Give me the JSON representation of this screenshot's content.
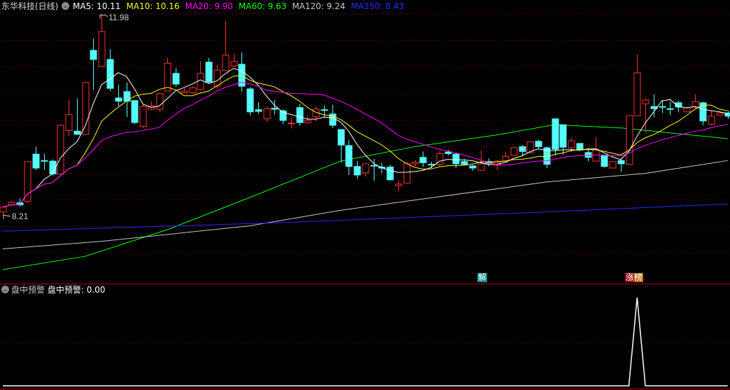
{
  "header": {
    "title": "东华科技(日线)",
    "ma_legend": [
      {
        "name": "MA5",
        "value": "10.11",
        "color": "#ffffff"
      },
      {
        "name": "MA10",
        "value": "10.16",
        "color": "#ffff00"
      },
      {
        "name": "MA20",
        "value": "9.90",
        "color": "#ff00ff"
      },
      {
        "name": "MA60",
        "value": "9.63",
        "color": "#00ff00"
      },
      {
        "name": "MA120",
        "value": "9.24",
        "color": "#c8c8c8"
      },
      {
        "name": "MA250",
        "value": "8.43",
        "color": "#2a2aff"
      }
    ]
  },
  "indicator": {
    "title": "盘中预警",
    "label": "盘中预警",
    "value": "0.00"
  },
  "markers": {
    "jie": "解",
    "zhangbang": "涨榜"
  },
  "annotations": {
    "high": "11.98",
    "low": "8.21"
  },
  "colors": {
    "up": "#ff3232",
    "down": "#54fcfc",
    "grid": "#8b0000",
    "border": "#b00000"
  },
  "chart_data": {
    "type": "candlestick",
    "title": "东华科技(日线)",
    "ylim": [
      6.9,
      12.0
    ],
    "ohlc": [
      [
        8.28,
        8.38,
        8.21,
        8.37
      ],
      [
        8.41,
        8.48,
        8.38,
        8.46
      ],
      [
        8.45,
        8.53,
        8.38,
        8.41
      ],
      [
        8.48,
        9.22,
        8.45,
        9.22
      ],
      [
        9.36,
        9.5,
        9.06,
        9.1
      ],
      [
        9.24,
        9.37,
        9.07,
        9.23
      ],
      [
        9.23,
        9.26,
        8.96,
        8.99
      ],
      [
        8.99,
        9.9,
        8.97,
        9.9
      ],
      [
        9.8,
        10.38,
        9.7,
        10.1
      ],
      [
        9.79,
        10.4,
        9.73,
        9.73
      ],
      [
        9.73,
        10.7,
        9.73,
        10.7
      ],
      [
        11.3,
        11.52,
        10.56,
        11.13
      ],
      [
        11.0,
        11.98,
        11.0,
        11.65
      ],
      [
        11.13,
        11.32,
        10.54,
        10.59
      ],
      [
        10.41,
        10.66,
        10.26,
        10.35
      ],
      [
        10.53,
        10.7,
        10.05,
        10.35
      ],
      [
        10.36,
        10.37,
        9.92,
        9.95
      ],
      [
        9.88,
        10.3,
        9.85,
        10.25
      ],
      [
        10.2,
        10.35,
        10.18,
        10.26
      ],
      [
        10.2,
        10.49,
        10.14,
        10.49
      ],
      [
        10.54,
        11.17,
        10.54,
        11.06
      ],
      [
        10.87,
        10.97,
        10.62,
        10.67
      ],
      [
        10.51,
        10.59,
        10.5,
        10.54
      ],
      [
        10.51,
        10.62,
        10.49,
        10.6
      ],
      [
        10.57,
        11.1,
        10.55,
        10.87
      ],
      [
        11.08,
        11.16,
        10.68,
        10.71
      ],
      [
        10.63,
        11.03,
        10.58,
        10.93
      ],
      [
        10.92,
        11.85,
        10.92,
        11.21
      ],
      [
        11.01,
        11.23,
        10.98,
        11.09
      ],
      [
        11.04,
        11.26,
        10.53,
        10.63
      ],
      [
        10.58,
        10.61,
        10.08,
        10.15
      ],
      [
        10.19,
        10.33,
        10.11,
        10.16
      ],
      [
        10.02,
        10.25,
        9.96,
        10.21
      ],
      [
        10.22,
        10.37,
        10.1,
        10.2
      ],
      [
        10.17,
        10.2,
        9.92,
        9.99
      ],
      [
        9.93,
        10.05,
        9.84,
        9.94
      ],
      [
        10.23,
        10.3,
        9.89,
        9.95
      ],
      [
        9.95,
        10.08,
        9.93,
        9.99
      ],
      [
        10.06,
        10.25,
        9.97,
        10.2
      ],
      [
        10.19,
        10.27,
        10.04,
        10.18
      ],
      [
        10.11,
        10.28,
        9.85,
        9.9
      ],
      [
        9.82,
        9.82,
        9.2,
        9.53
      ],
      [
        9.52,
        9.62,
        8.97,
        9.13
      ],
      [
        9.13,
        9.23,
        8.9,
        8.97
      ],
      [
        9.01,
        9.18,
        8.94,
        9.18
      ],
      [
        9.15,
        9.27,
        8.86,
        9.14
      ],
      [
        9.12,
        9.2,
        9.0,
        9.1
      ],
      [
        9.12,
        9.16,
        8.87,
        8.88
      ],
      [
        8.77,
        8.86,
        8.67,
        8.8
      ],
      [
        8.82,
        9.21,
        8.81,
        9.19
      ],
      [
        9.18,
        9.25,
        9.14,
        9.21
      ],
      [
        9.3,
        9.41,
        9.12,
        9.2
      ],
      [
        9.17,
        9.22,
        9.1,
        9.16
      ],
      [
        9.17,
        9.42,
        9.14,
        9.37
      ],
      [
        9.4,
        9.44,
        9.33,
        9.37
      ],
      [
        9.36,
        9.38,
        9.1,
        9.18
      ],
      [
        9.22,
        9.27,
        9.15,
        9.17
      ],
      [
        9.14,
        9.16,
        9.05,
        9.1
      ],
      [
        9.06,
        9.43,
        9.06,
        9.18
      ],
      [
        9.22,
        9.28,
        9.13,
        9.19
      ],
      [
        9.15,
        9.25,
        9.06,
        9.23
      ],
      [
        9.24,
        9.4,
        9.2,
        9.32
      ],
      [
        9.34,
        9.48,
        9.34,
        9.48
      ],
      [
        9.5,
        9.53,
        9.34,
        9.41
      ],
      [
        9.39,
        9.59,
        9.36,
        9.59
      ],
      [
        9.6,
        9.63,
        9.47,
        9.5
      ],
      [
        9.48,
        9.5,
        9.1,
        9.17
      ],
      [
        10.02,
        10.02,
        9.34,
        9.45
      ],
      [
        9.91,
        9.91,
        9.35,
        9.49
      ],
      [
        9.48,
        9.66,
        9.4,
        9.61
      ],
      [
        9.56,
        9.56,
        9.44,
        9.44
      ],
      [
        9.39,
        9.44,
        9.23,
        9.3
      ],
      [
        9.23,
        9.68,
        9.23,
        9.45
      ],
      [
        9.34,
        9.35,
        9.11,
        9.13
      ],
      [
        9.1,
        9.22,
        9.1,
        9.22
      ],
      [
        9.24,
        9.29,
        9.03,
        9.18
      ],
      [
        9.17,
        10.08,
        9.17,
        10.08
      ],
      [
        10.08,
        11.22,
        10.08,
        10.88
      ],
      [
        10.3,
        10.4,
        9.77,
        10.37
      ],
      [
        10.25,
        10.48,
        10.05,
        10.21
      ],
      [
        10.25,
        10.37,
        10.13,
        10.24
      ],
      [
        10.21,
        10.33,
        10.09,
        10.2
      ],
      [
        10.32,
        10.36,
        10.14,
        10.24
      ],
      [
        10.15,
        10.25,
        10.15,
        10.23
      ],
      [
        10.24,
        10.48,
        10.2,
        10.34
      ],
      [
        10.32,
        10.34,
        9.9,
        9.98
      ],
      [
        9.92,
        10.17,
        9.9,
        10.07
      ],
      [
        10.09,
        10.16,
        10.09,
        10.13
      ],
      [
        10.13,
        10.17,
        10.02,
        10.07
      ]
    ],
    "long_ma": [
      {
        "name": "MA60",
        "color": "#00ff00",
        "points": [
          [
            0,
            7.2
          ],
          [
            10,
            7.45
          ],
          [
            20,
            7.95
          ],
          [
            30,
            8.55
          ],
          [
            41,
            9.23
          ],
          [
            50,
            9.5
          ],
          [
            60,
            9.72
          ],
          [
            67,
            9.91
          ],
          [
            75,
            9.85
          ],
          [
            88,
            9.65
          ]
        ]
      },
      {
        "name": "MA120",
        "color": "#c8c8c8",
        "points": [
          [
            0,
            7.59
          ],
          [
            12,
            7.73
          ],
          [
            30,
            8.02
          ],
          [
            41,
            8.31
          ],
          [
            66,
            8.84
          ],
          [
            78,
            9.0
          ],
          [
            88,
            9.24
          ]
        ]
      },
      {
        "name": "MA250",
        "color": "#2a2aff",
        "points": [
          [
            0,
            7.92
          ],
          [
            34,
            8.08
          ],
          [
            66,
            8.28
          ],
          [
            88,
            8.43
          ]
        ]
      }
    ],
    "indicator_values": [
      0,
      0,
      0,
      0,
      0,
      0,
      0,
      0,
      0,
      0,
      0,
      0,
      0,
      0,
      0,
      0,
      0,
      0,
      0,
      0,
      0,
      0,
      0,
      0,
      0,
      0,
      0,
      0,
      0,
      0,
      0,
      0,
      0,
      0,
      0,
      0,
      0,
      0,
      0,
      0,
      0,
      0,
      0,
      0,
      0,
      0,
      0,
      0,
      0,
      0,
      0,
      0,
      0,
      0,
      0,
      0,
      0,
      0,
      0,
      0,
      0,
      0,
      0,
      0,
      0,
      0,
      0,
      0,
      0,
      0,
      0,
      0,
      0,
      0,
      0,
      0,
      0,
      1,
      0,
      0,
      0,
      0,
      0,
      0,
      0,
      0,
      0,
      0,
      0
    ],
    "indicator_ylim": [
      0,
      1.1
    ]
  }
}
